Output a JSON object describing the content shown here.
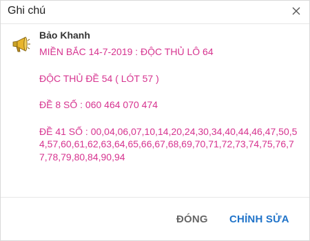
{
  "dialog": {
    "title": "Ghi chú",
    "close_icon": "close-icon"
  },
  "note": {
    "author": "Bảo Khanh",
    "icon": "megaphone-icon",
    "paragraphs": [
      "MIỀN BẮC 14-7-2019 : ĐỘC THỦ LÔ 64",
      "ĐỘC THỦ ĐỀ 54 ( LÓT 57 )",
      "ĐỀ 8 SỐ : 060 464 070 474",
      "ĐỀ 41 SỐ : 00,04,06,07,10,14,20,24,30,34,40,44,46,47,50,54,57,60,61,62,63,64,65,66,67,68,69,70,71,72,73,74,75,76,77,78,79,80,84,90,94"
    ],
    "text_color": "#d6338f"
  },
  "footer": {
    "close_label": "ĐÓNG",
    "edit_label": "CHỈNH SỬA",
    "edit_color": "#1f73c9"
  }
}
